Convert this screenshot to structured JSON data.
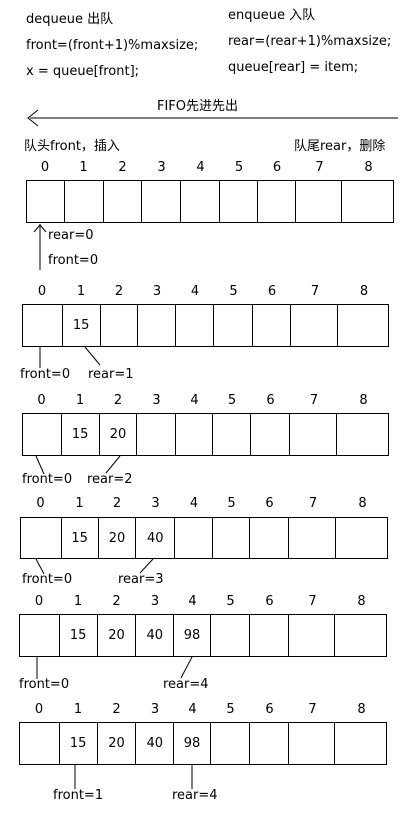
{
  "dequeue": {
    "title": "dequeue 出队",
    "line1": "front=(front+1)%maxsize;",
    "line2": "x = queue[front];"
  },
  "enqueue": {
    "title": "enqueue 入队",
    "line1": "rear=(rear+1)%maxsize;",
    "line2": "queue[rear] = item;"
  },
  "fifo_label": "FIFO先进先出",
  "head_label": "队头front，插入",
  "tail_label": "队尾rear，删除",
  "indices": [
    "0",
    "1",
    "2",
    "3",
    "4",
    "5",
    "6",
    "7",
    "8"
  ],
  "states": [
    {
      "values": [
        "",
        "",
        "",
        "",
        "",
        "",
        "",
        "",
        ""
      ],
      "front": "front=0",
      "rear": "rear=0"
    },
    {
      "values": [
        "",
        "15",
        "",
        "",
        "",
        "",
        "",
        "",
        ""
      ],
      "front": "front=0",
      "rear": "rear=1"
    },
    {
      "values": [
        "",
        "15",
        "20",
        "",
        "",
        "",
        "",
        "",
        ""
      ],
      "front": "front=0",
      "rear": "rear=2"
    },
    {
      "values": [
        "",
        "15",
        "20",
        "40",
        "",
        "",
        "",
        "",
        ""
      ],
      "front": "front=0",
      "rear": "rear=3"
    },
    {
      "values": [
        "",
        "15",
        "20",
        "40",
        "98",
        "",
        "",
        "",
        ""
      ],
      "front": "front=0",
      "rear": "rear=4"
    },
    {
      "values": [
        "",
        "15",
        "20",
        "40",
        "98",
        "",
        "",
        "",
        ""
      ],
      "front": "front=1",
      "rear": "rear=4"
    }
  ]
}
